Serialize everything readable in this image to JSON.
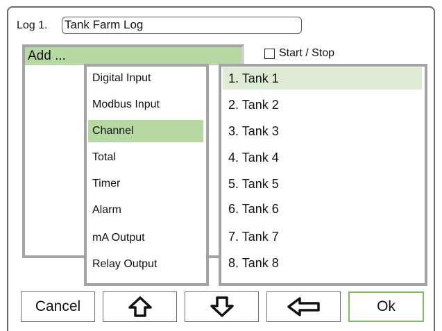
{
  "log": {
    "label": "Log 1.",
    "name": "Tank Farm Log"
  },
  "start_stop": {
    "label": "Start / Stop",
    "checked": false
  },
  "add_list": {
    "header": "Add ..."
  },
  "input_types": {
    "items": [
      "Digital Input",
      "Modbus Input",
      "Channel",
      "Total",
      "Timer",
      "Alarm",
      "mA Output",
      "Relay Output"
    ],
    "selected_index": 2
  },
  "sources": {
    "items": [
      "1. Tank 1",
      "2. Tank 2",
      "3. Tank 3",
      "4. Tank 4",
      "5. Tank 5",
      "6. Tank 6",
      "7. Tank 7",
      "8. Tank 8"
    ],
    "selected_index": 0
  },
  "buttons": {
    "cancel": "Cancel",
    "up_icon": "arrow-up-icon",
    "down_icon": "arrow-down-icon",
    "back_icon": "arrow-left-icon",
    "ok": "Ok"
  },
  "colors": {
    "selection": "#b6d8a3",
    "selection_light": "#dcebd3",
    "ok_border": "#7fbd60",
    "panel_border": "#a3a3a3"
  }
}
